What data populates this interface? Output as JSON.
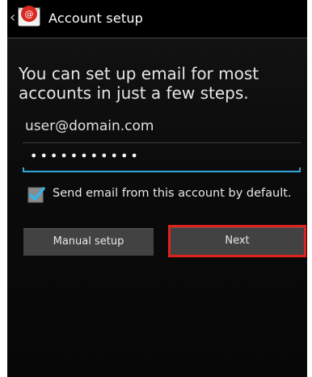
{
  "actionbar": {
    "title": "Account setup"
  },
  "intro": {
    "text": "You can set up email for most accounts in just a few steps."
  },
  "email_field": {
    "value": "user@domain.com"
  },
  "password_field": {
    "masked_value": "•••••••••••"
  },
  "default_checkbox": {
    "checked": true,
    "label": "Send email from this account by default."
  },
  "buttons": {
    "manual_setup": "Manual setup",
    "next": "Next"
  },
  "colors": {
    "accent_blue": "#2fa8d8",
    "highlight_red": "#e1221c",
    "background": "#0b0b0b"
  },
  "icons": {
    "back": "chevron-left-icon",
    "app": "email-app-icon",
    "checkbox": "checkmark-icon"
  }
}
